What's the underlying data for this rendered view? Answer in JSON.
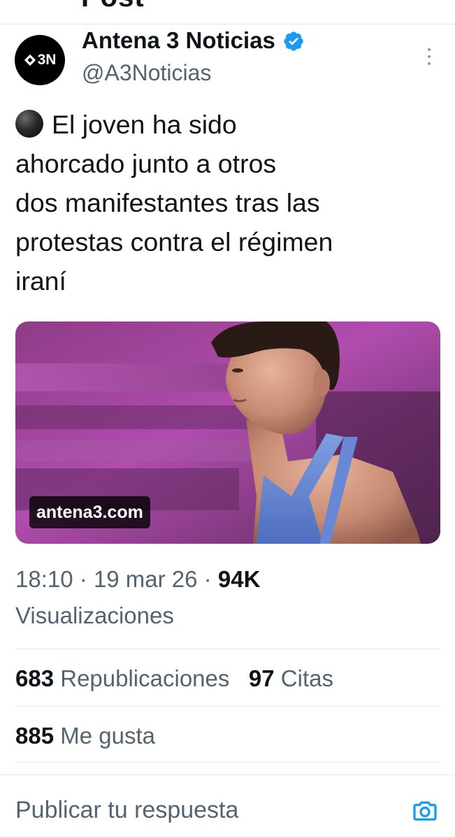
{
  "header": {
    "title": "Post"
  },
  "post": {
    "author": {
      "avatar_text": "3N",
      "name": "Antena 3 Noticias",
      "handle": "@A3Noticias",
      "verified_icon": "verified-badge-icon"
    },
    "text_lines": [
      "El joven ha sido",
      "ahorcado junto a otros",
      "dos manifestantes tras las",
      "protestas contra el régimen",
      "iraní"
    ],
    "media": {
      "domain": "antena3.com"
    },
    "time": "18:10",
    "date": "19 mar 26",
    "views_count": "94K",
    "views_label": "Visualizaciones",
    "separator": "·",
    "stats": {
      "reposts_count": "683",
      "reposts_label": "Republicaciones",
      "quotes_count": "97",
      "quotes_label": "Citas",
      "likes_count": "885",
      "likes_label": "Me gusta"
    }
  },
  "reply": {
    "placeholder": "Publicar tu respuesta",
    "camera_icon": "camera-icon"
  },
  "colors": {
    "text_primary": "#0f1419",
    "text_secondary": "#536471",
    "verified_blue": "#1d9bf0",
    "divider": "#e6e9ec"
  }
}
